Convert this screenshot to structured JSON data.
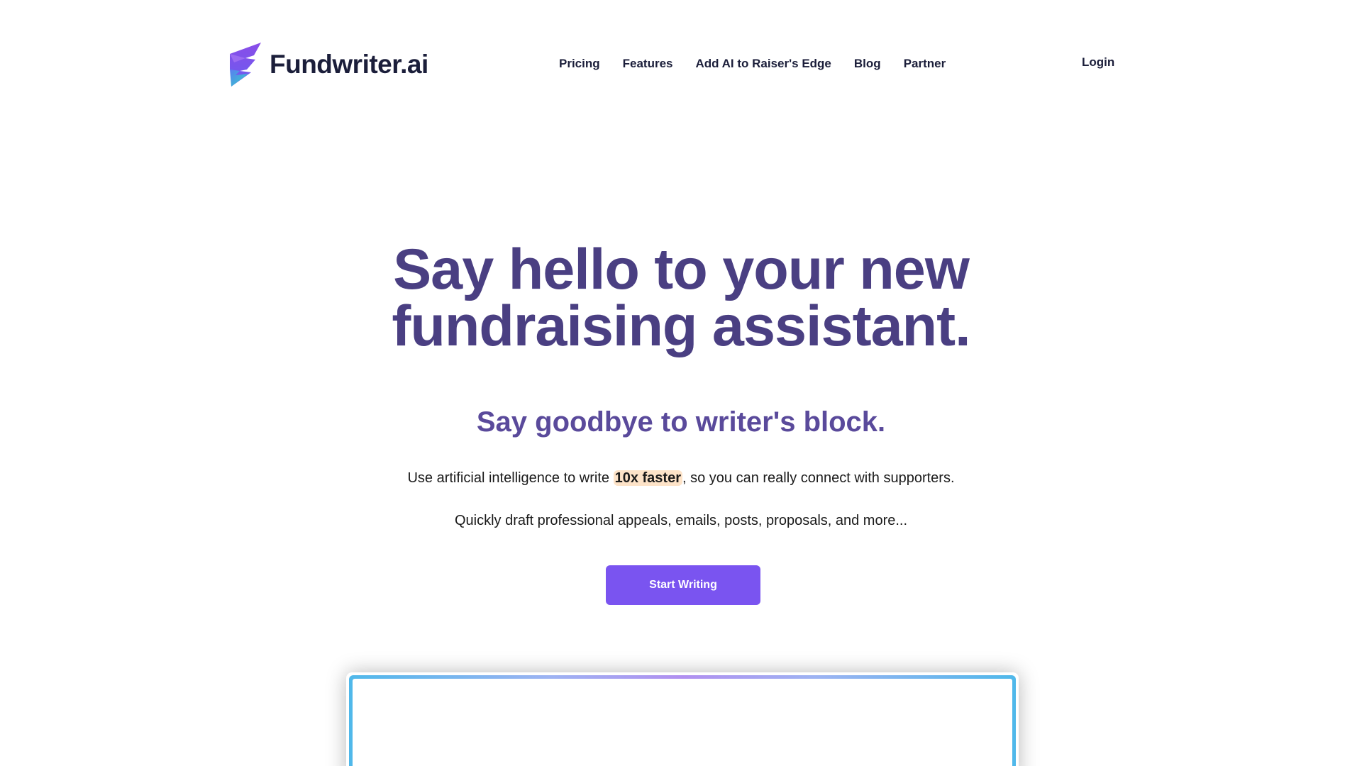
{
  "brand": {
    "name": "Fundwriter.ai",
    "colors": {
      "primary_text": "#4a3f82",
      "subtitle": "#5a4a9b",
      "cta": "#7a54f0",
      "highlight": "#fde3c8",
      "logo_purple": "#8a4de8",
      "logo_teal": "#2fd6c4"
    }
  },
  "nav": {
    "items": [
      {
        "label": "Pricing"
      },
      {
        "label": "Features"
      },
      {
        "label": "Add AI to Raiser's Edge"
      },
      {
        "label": "Blog"
      },
      {
        "label": "Partner"
      }
    ],
    "login_label": "Login"
  },
  "hero": {
    "title_line1": "Say hello to your new",
    "title_line2": "fundraising assistant.",
    "subtitle": "Say goodbye to writer's block.",
    "body_prefix": "Use artificial intelligence to write ",
    "body_highlight": "10x faster",
    "body_suffix": ", so you can really connect with supporters.",
    "body_line2": "Quickly draft professional appeals, emails, posts, proposals, and more...",
    "cta_label": "Start Writing"
  },
  "icons": {
    "logo": "fundwriter-logo-icon"
  }
}
